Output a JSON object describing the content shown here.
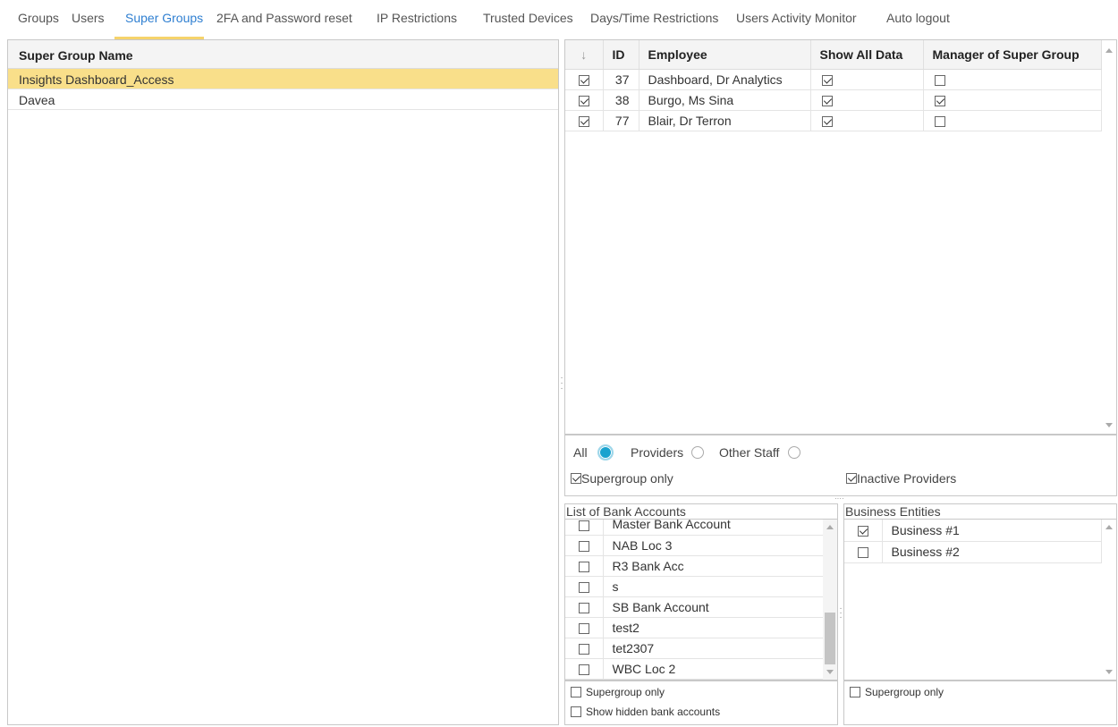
{
  "tabs": [
    {
      "label": "Groups"
    },
    {
      "label": "Users"
    },
    {
      "label": "Super Groups"
    },
    {
      "label": "2FA and Password reset"
    },
    {
      "label": "IP Restrictions"
    },
    {
      "label": "Trusted Devices"
    },
    {
      "label": "Days/Time Restrictions"
    },
    {
      "label": "Users Activity Monitor"
    },
    {
      "label": "Auto logout"
    }
  ],
  "active_tab": "Super Groups",
  "supergroups": {
    "header": "Super Group Name",
    "rows": [
      {
        "name": "Insights Dashboard_Access",
        "selected": true
      },
      {
        "name": "Davea",
        "selected": false
      }
    ]
  },
  "employees": {
    "columns": {
      "sort": "↓",
      "id": "ID",
      "employee": "Employee",
      "show_all": "Show All Data",
      "manager": "Manager of Super Group"
    },
    "rows": [
      {
        "checked": true,
        "id": "37",
        "name": "Dashboard, Dr Analytics",
        "show_all": true,
        "manager": false
      },
      {
        "checked": true,
        "id": "38",
        "name": "Burgo, Ms Sina",
        "show_all": true,
        "manager": true
      },
      {
        "checked": true,
        "id": "77",
        "name": "Blair, Dr Terron",
        "show_all": true,
        "manager": false
      }
    ]
  },
  "filters": {
    "radio_all": "All",
    "radio_providers": "Providers",
    "radio_other": "Other Staff",
    "selected_radio": "All",
    "supergroup_only": "Supergroup only",
    "inactive_providers": "Inactive Providers"
  },
  "bank_accounts": {
    "title": "List of Bank Accounts",
    "rows": [
      {
        "name": "Master Bank Account"
      },
      {
        "name": "NAB Loc 3"
      },
      {
        "name": "R3 Bank Acc"
      },
      {
        "name": "s"
      },
      {
        "name": "SB Bank Account"
      },
      {
        "name": "test2"
      },
      {
        "name": "tet2307"
      },
      {
        "name": "WBC Loc 2"
      }
    ],
    "supergroup_only": "Supergroup only",
    "show_hidden": "Show hidden bank accounts"
  },
  "business_entities": {
    "title": "Business Entities",
    "rows": [
      {
        "name": "Business #1",
        "checked": true
      },
      {
        "name": "Business #2",
        "checked": false
      }
    ],
    "supergroup_only": "Supergroup only"
  },
  "colors": {
    "active_tab_text": "#2f7fd1",
    "tab_underline": "#f6d36b",
    "selected_row": "#f9df8a",
    "radio_selected": "#1aa3cf"
  }
}
